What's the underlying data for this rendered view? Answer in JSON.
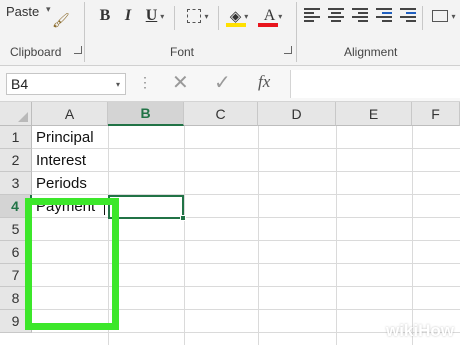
{
  "ribbon": {
    "paste_label": "Paste",
    "bold_label": "B",
    "italic_label": "I",
    "underline_label": "U",
    "font_color_label": "A",
    "clipboard_group": "Clipboard",
    "font_group": "Font",
    "alignment_group": "Alignment",
    "fill_color": "#ffe000",
    "font_color": "#e8141c"
  },
  "formula_bar": {
    "name_box": "B4",
    "dots": "⋮",
    "cancel": "✕",
    "enter": "✓",
    "fx": "fx"
  },
  "sheet": {
    "columns": [
      "A",
      "B",
      "C",
      "D",
      "E",
      "F"
    ],
    "selected_column": "B",
    "rows": [
      "1",
      "2",
      "3",
      "4",
      "5",
      "6",
      "7",
      "8",
      "9"
    ],
    "selected_row": "4",
    "cells_a": [
      "Principal",
      "Interest",
      "Periods",
      "Payment"
    ],
    "accent": "#217346",
    "highlight": "#3ce72a"
  },
  "watermark": {
    "wiki": "wiki",
    "how": "How"
  }
}
